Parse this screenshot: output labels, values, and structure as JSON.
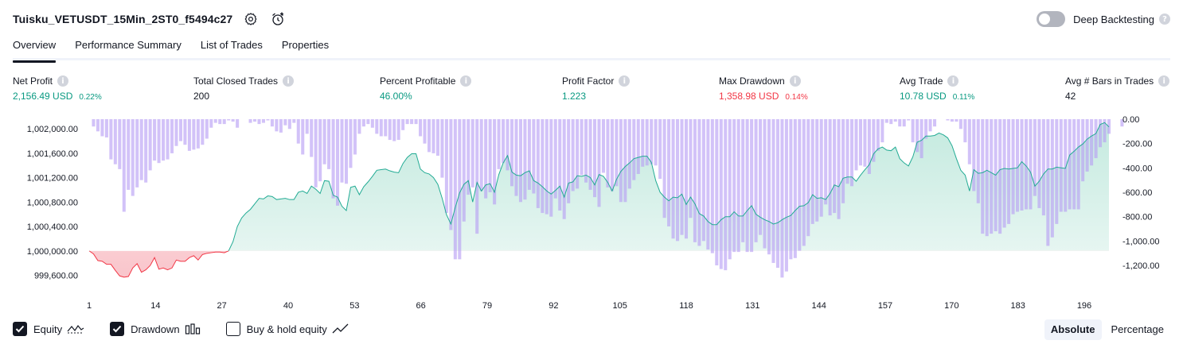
{
  "header": {
    "title": "Tuisku_VETUSDT_15Min_2ST0_f5494c27",
    "settings_icon": "gear-icon",
    "alert_icon": "add-alert-icon"
  },
  "deep_backtesting": {
    "label": "Deep Backtesting",
    "enabled": false
  },
  "tabs": [
    {
      "label": "Overview",
      "active": true
    },
    {
      "label": "Performance Summary",
      "active": false
    },
    {
      "label": "List of Trades",
      "active": false
    },
    {
      "label": "Properties",
      "active": false
    }
  ],
  "metrics": [
    {
      "label": "Net Profit",
      "value": "2,156.49 USD",
      "sub": "0.22%",
      "color": "#089981"
    },
    {
      "label": "Total Closed Trades",
      "value": "200",
      "sub": "",
      "color": "#131722"
    },
    {
      "label": "Percent Profitable",
      "value": "46.00%",
      "sub": "",
      "color": "#089981"
    },
    {
      "label": "Profit Factor",
      "value": "1.223",
      "sub": "",
      "color": "#089981"
    },
    {
      "label": "Max Drawdown",
      "value": "1,358.98 USD",
      "sub": "0.14%",
      "color": "#f23645"
    },
    {
      "label": "Avg Trade",
      "value": "10.78 USD",
      "sub": "0.11%",
      "color": "#089981"
    },
    {
      "label": "Avg # Bars in Trades",
      "value": "42",
      "sub": "",
      "color": "#131722"
    }
  ],
  "chart_data": {
    "type": "area",
    "series": [
      {
        "name": "Equity",
        "kind": "area",
        "axis": "left",
        "values": [
          1000000,
          999950,
          999840,
          999830,
          999780,
          999780,
          999680,
          999590,
          999570,
          999580,
          999720,
          999790,
          999650,
          999690,
          999760,
          999890,
          999700,
          999720,
          999690,
          999720,
          999850,
          999830,
          999830,
          999890,
          999920,
          999850,
          999940,
          999960,
          999970,
          999980,
          999980,
          999970,
          1000000,
          1000150,
          1000400,
          1000540,
          1000620,
          1000680,
          1000770,
          1000860,
          1000850,
          1000900,
          1000890,
          1000840,
          1000850,
          1000860,
          1000840,
          1000840,
          1000960,
          1000980,
          1000940,
          1001060,
          1001010,
          1000940,
          1001150,
          1001140,
          1000910,
          1000880,
          1000730,
          1000660,
          1001040,
          1001060,
          1000920,
          1001050,
          1001130,
          1001220,
          1001320,
          1001330,
          1001340,
          1001310,
          1001290,
          1001280,
          1001430,
          1001530,
          1001590,
          1001590,
          1001340,
          1001280,
          1001260,
          1001200,
          1001090,
          1000860,
          1000590,
          1000440,
          1000710,
          1000950,
          1001090,
          1001150,
          1000800,
          1001120,
          1000980,
          1001080,
          1001100,
          1000960,
          1001250,
          1001440,
          1001560,
          1001290,
          1001240,
          1001230,
          1001280,
          1001310,
          1001150,
          1001110,
          1001050,
          1000980,
          1000930,
          1000990,
          1001060,
          1000880,
          1001110,
          1001130,
          1001230,
          1001220,
          1001240,
          1001200,
          1001080,
          1001250,
          1001220,
          1001120,
          1000980,
          1001170,
          1001300,
          1001380,
          1001440,
          1001510,
          1001530,
          1001550,
          1001550,
          1001450,
          1001150,
          1000960,
          1000880,
          1000820,
          1000880,
          1000870,
          1000930,
          1000760,
          1000880,
          1000770,
          1000610,
          1000570,
          1000480,
          1000430,
          1000430,
          1000510,
          1000560,
          1000560,
          1000640,
          1000570,
          1000570,
          1000660,
          1000740,
          1000600,
          1000550,
          1000510,
          1000480,
          1000440,
          1000460,
          1000510,
          1000550,
          1000580,
          1000660,
          1000730,
          1000740,
          1000790,
          1000920,
          1000860,
          1000870,
          1000840,
          1000940,
          1001080,
          1001050,
          1001190,
          1001210,
          1001210,
          1001140,
          1001240,
          1001330,
          1001410,
          1001590,
          1001670,
          1001700,
          1001650,
          1001640,
          1001700,
          1001510,
          1001440,
          1001390,
          1001540,
          1001780,
          1001810,
          1001880,
          1001880,
          1001890,
          1001930,
          1001900,
          1001850,
          1001720,
          1001510,
          1001320,
          1001240,
          1000980,
          1001330,
          1001270,
          1001280,
          1001320,
          1001280,
          1001240,
          1001330,
          1001350,
          1001340,
          1001350,
          1001360,
          1001460,
          1001390,
          1001290,
          1001060,
          1001140,
          1001260,
          1001340,
          1001340,
          1001370,
          1001360,
          1001350,
          1001570,
          1001630,
          1001700,
          1001750,
          1001830,
          1001880,
          1001920,
          1002070,
          1002100,
          1002030
        ]
      },
      {
        "name": "Drawdown",
        "kind": "bars",
        "axis": "right",
        "values": [
          0,
          -60,
          -100,
          -140,
          -150,
          -330,
          -370,
          -410,
          -760,
          -580,
          -630,
          -560,
          -500,
          -520,
          -420,
          -340,
          -360,
          -340,
          -330,
          -280,
          -220,
          -180,
          -210,
          -260,
          -250,
          -240,
          -210,
          -160,
          -70,
          -30,
          -40,
          -40,
          -10,
          -20,
          -70,
          0,
          0,
          -30,
          -20,
          -40,
          -30,
          -10,
          -60,
          -100,
          -110,
          -50,
          -80,
          -30,
          -200,
          -290,
          -120,
          -310,
          -560,
          -510,
          -370,
          -410,
          -650,
          -710,
          -520,
          -530,
          -400,
          -290,
          -120,
          -60,
          -40,
          -70,
          -120,
          -140,
          -140,
          -170,
          -180,
          -170,
          -90,
          -40,
          -40,
          -40,
          -140,
          -200,
          -270,
          -280,
          -300,
          -480,
          -770,
          -910,
          -1150,
          -1150,
          -840,
          -620,
          -560,
          -940,
          -590,
          -650,
          -600,
          -700,
          -410,
          -360,
          -420,
          -550,
          -630,
          -680,
          -660,
          -580,
          -610,
          -730,
          -770,
          -780,
          -800,
          -650,
          -750,
          -820,
          -690,
          -590,
          -570,
          -460,
          -520,
          -580,
          -640,
          -720,
          -440,
          -560,
          -590,
          -550,
          -680,
          -680,
          -570,
          -500,
          -450,
          -390,
          -380,
          -370,
          -380,
          -490,
          -810,
          -880,
          -980,
          -1000,
          -950,
          -980,
          -810,
          -1010,
          -1040,
          -1000,
          -1070,
          -1100,
          -1200,
          -1230,
          -1240,
          -1150,
          -1090,
          -1090,
          -1010,
          -1090,
          -1090,
          -1010,
          -950,
          -1060,
          -1110,
          -1180,
          -1220,
          -1300,
          -1250,
          -1150,
          -1140,
          -1080,
          -1040,
          -960,
          -860,
          -840,
          -800,
          -700,
          -790,
          -770,
          -820,
          -690,
          -530,
          -550,
          -420,
          -380,
          -390,
          -450,
          -350,
          -260,
          -190,
          -30,
          -40,
          -20,
          -60,
          -60,
          -10,
          -190,
          -270,
          -320,
          -160,
          -100,
          -60,
          0,
          0,
          -10,
          -20,
          -20,
          -80,
          -190,
          -370,
          -590,
          -690,
          -940,
          -960,
          -940,
          -920,
          -940,
          -890,
          -860,
          -780,
          -760,
          -750,
          -740,
          -740,
          -630,
          -730,
          -790,
          -1040,
          -970,
          -860,
          -760,
          -760,
          -740,
          -740,
          -740,
          -510,
          -430,
          -380,
          -320,
          -230,
          -190,
          -120,
          0,
          0,
          -60
        ]
      }
    ],
    "x_ticks": [
      "1",
      "14",
      "27",
      "40",
      "53",
      "66",
      "79",
      "92",
      "105",
      "118",
      "131",
      "144",
      "157",
      "170",
      "183",
      "196"
    ],
    "x_range": [
      1,
      200
    ],
    "y_left_ticks": [
      "1,002,000.00",
      "1,001,600.00",
      "1,001,200.00",
      "1,000,800.00",
      "1,000,400.00",
      "1,000,000.00",
      "999,600.00"
    ],
    "y_left_values": [
      1002000,
      1001600,
      1001200,
      1000800,
      1000400,
      1000000,
      999600
    ],
    "y_right_ticks": [
      "0.00",
      "-200.00",
      "-400.00",
      "-600.00",
      "-800.00",
      "-1,000.00",
      "-1,200.00"
    ],
    "y_right_values": [
      0,
      -200,
      -400,
      -600,
      -800,
      -1000,
      -1200
    ],
    "baseline": 1000000,
    "grid": false,
    "colors": {
      "equity_line_pos": "#22ab94",
      "equity_line_neg": "#f23645",
      "equity_fill_pos": "#d6f0ea",
      "equity_fill_neg": "#fcd7db",
      "drawdown_bar": "#b79cf3"
    }
  },
  "legend": [
    {
      "label": "Equity",
      "checked": true,
      "icon": "equity-line-icon"
    },
    {
      "label": "Drawdown",
      "checked": true,
      "icon": "bar-chart-icon"
    },
    {
      "label": "Buy & hold equity",
      "checked": false,
      "icon": "trend-line-icon"
    }
  ],
  "mode": {
    "absolute": "Absolute",
    "percentage": "Percentage",
    "selected": "Absolute"
  }
}
